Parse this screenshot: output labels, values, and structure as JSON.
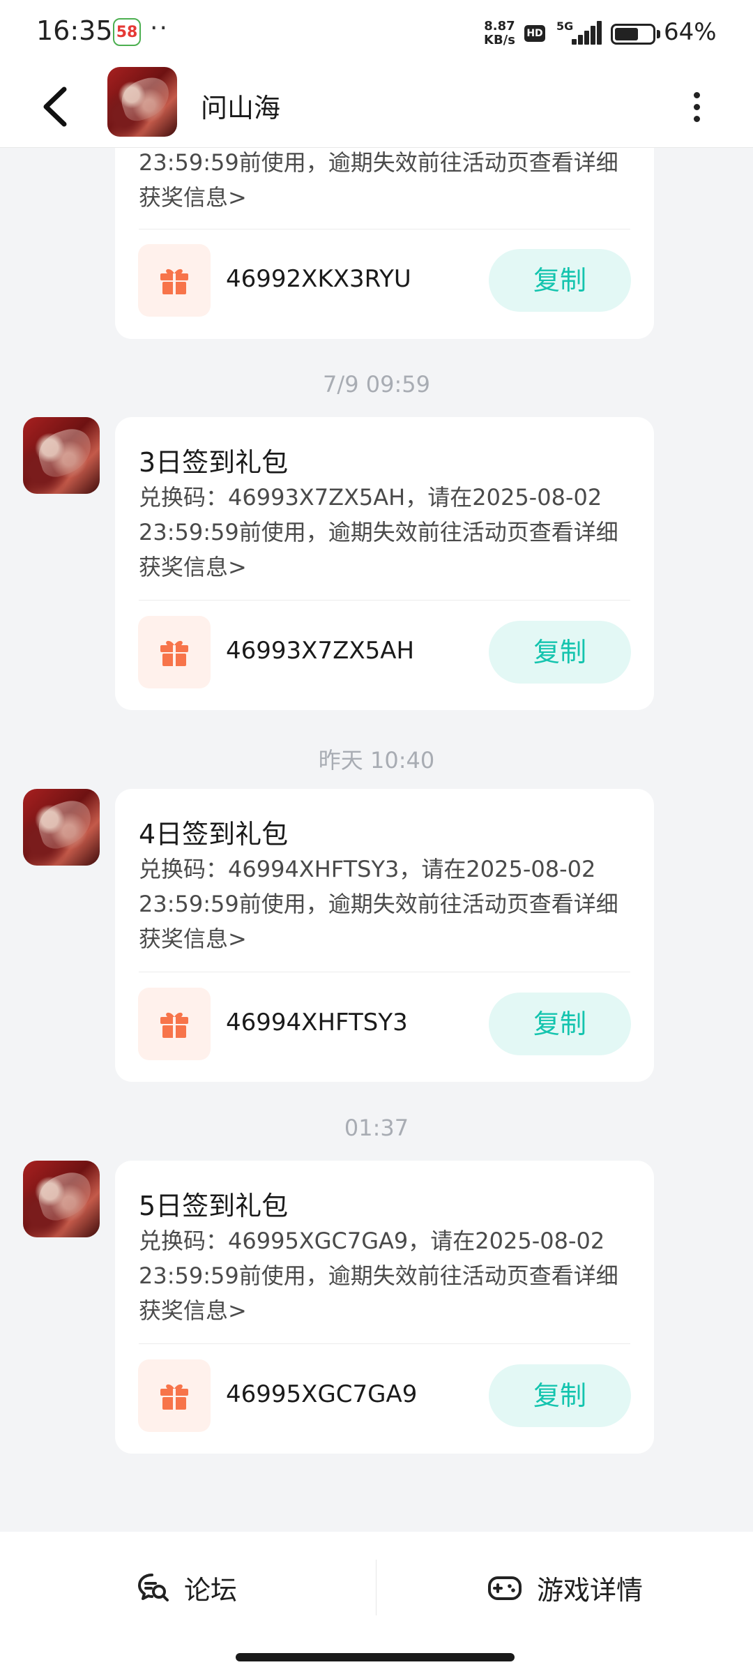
{
  "status_bar": {
    "time": "16:35",
    "app_badge": "58",
    "dots": "··",
    "net_speed_value": "8.87",
    "net_speed_unit": "KB/s",
    "hd": "HD",
    "network": "5G",
    "battery_percent": "64%",
    "battery_level": 0.64
  },
  "header": {
    "title": "问山海",
    "back_icon": "chevron-left-icon",
    "more_icon": "more-vertical-icon"
  },
  "messages": [
    {
      "timestamp": "",
      "title": "",
      "body_tail": "23:59:59前使用，逾期失效前往活动页查看详细获奖信息>",
      "code": "46992XKX3RYU",
      "copy_label": "复制"
    },
    {
      "timestamp": "7/9  09:59",
      "title": "3日签到礼包",
      "body": "兑换码：46993X7ZX5AH，请在2025-08-02 23:59:59前使用，逾期失效前往活动页查看详细获奖信息>",
      "code": "46993X7ZX5AH",
      "copy_label": "复制"
    },
    {
      "timestamp": "昨天  10:40",
      "title": "4日签到礼包",
      "body": "兑换码：46994XHFTSY3，请在2025-08-02 23:59:59前使用，逾期失效前往活动页查看详细获奖信息>",
      "code": "46994XHFTSY3",
      "copy_label": "复制"
    },
    {
      "timestamp": "01:37",
      "title": "5日签到礼包",
      "body": "兑换码：46995XGC7GA9，请在2025-08-02 23:59:59前使用，逾期失效前往活动页查看详细获奖信息>",
      "code": "46995XGC7GA9",
      "copy_label": "复制"
    }
  ],
  "bottom_bar": {
    "forum_label": "论坛",
    "forum_icon": "forum-search-icon",
    "details_label": "游戏详情",
    "details_icon": "gamepad-icon"
  },
  "colors": {
    "accent": "#14c4ae",
    "copy_bg": "#e3f8f5",
    "gift": "#f7744a",
    "gift_bg": "#fff1ec",
    "page_bg": "#f3f4f6"
  }
}
